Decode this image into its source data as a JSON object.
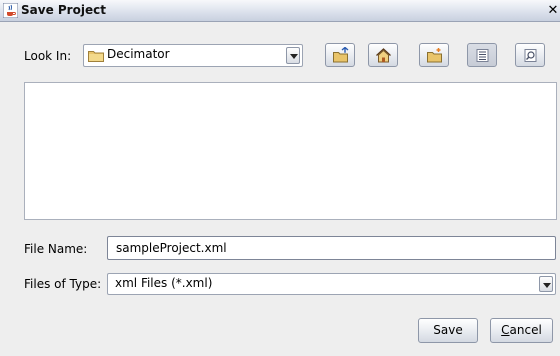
{
  "window": {
    "title": "Save Project",
    "close_glyph": "✕"
  },
  "look_in": {
    "label": "Look In:",
    "value": "Decimator"
  },
  "toolbar": {
    "buttons": [
      {
        "name": "up-one-level-button",
        "icon": "folder-up-icon"
      },
      {
        "name": "home-button",
        "icon": "home-icon"
      },
      {
        "name": "new-folder-button",
        "icon": "new-folder-icon"
      },
      {
        "name": "list-view-button",
        "icon": "list-view-icon",
        "active": true
      },
      {
        "name": "details-view-button",
        "icon": "details-view-icon"
      }
    ]
  },
  "file_name": {
    "label": "File Name:",
    "value": "sampleProject.xml"
  },
  "files_of_type": {
    "label": "Files of Type:",
    "value": "xml Files (*.xml)"
  },
  "actions": {
    "save_label": "Save",
    "cancel_first": "C",
    "cancel_rest": "ancel"
  },
  "colors": {
    "window_bg": "#eeeeee",
    "folder": "#e9c46a",
    "border": "#8e97a8"
  }
}
